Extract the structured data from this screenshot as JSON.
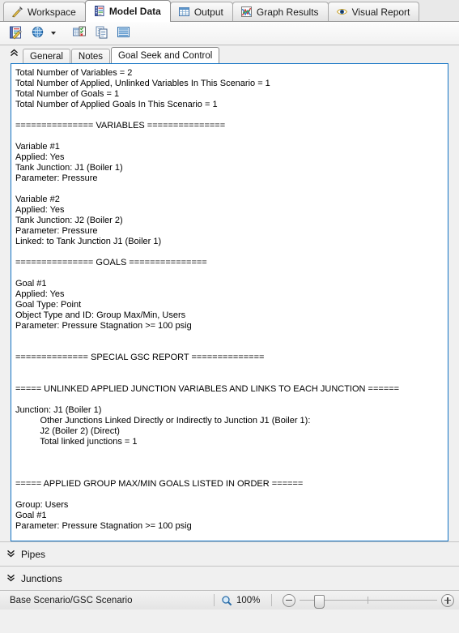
{
  "window": {
    "title": "Model Data - Goal Seek and Control"
  },
  "main_tabs": [
    {
      "label": "Workspace",
      "icon": "wrench-pencil-icon",
      "active": false
    },
    {
      "label": "Model Data",
      "icon": "notebook-icon",
      "active": true
    },
    {
      "label": "Output",
      "icon": "grid-table-icon",
      "active": false
    },
    {
      "label": "Graph Results",
      "icon": "chart-icon",
      "active": false
    },
    {
      "label": "Visual Report",
      "icon": "eye-icon",
      "active": false
    }
  ],
  "toolbar": {
    "buttons": [
      {
        "name": "edit-model-data-icon",
        "title": "Edit Model Data"
      },
      {
        "name": "globe-units-icon",
        "title": "Units"
      },
      {
        "name": "dropdown-caret-icon",
        "title": "More"
      },
      {
        "name": "show-object-status-icon",
        "title": "Show Object Status"
      },
      {
        "name": "copy-icon",
        "title": "Copy"
      },
      {
        "name": "list-lines-icon",
        "title": "Format"
      }
    ]
  },
  "sub_tabs": {
    "collapse_icon": "double-chevron-up-icon",
    "items": [
      {
        "label": "General",
        "active": false
      },
      {
        "label": "Notes",
        "active": false
      },
      {
        "label": "Goal Seek and Control",
        "active": true
      }
    ]
  },
  "report": {
    "lines": [
      "Total Number of Variables = 2",
      "Total Number of Applied, Unlinked Variables In This Scenario = 1",
      "Total Number of Goals = 1",
      "Total Number of Applied Goals In This Scenario = 1",
      "",
      "=============== VARIABLES ===============",
      "",
      "Variable #1",
      "Applied: Yes",
      "Tank Junction: J1 (Boiler 1)",
      "Parameter: Pressure",
      "",
      "Variable #2",
      "Applied: Yes",
      "Tank Junction: J2 (Boiler 2)",
      "Parameter: Pressure",
      "Linked: to Tank Junction J1 (Boiler 1)",
      "",
      "=============== GOALS ===============",
      "",
      "Goal #1",
      "Applied: Yes",
      "Goal Type: Point",
      "Object Type and ID: Group Max/Min, Users",
      "Parameter: Pressure Stagnation >= 100 psig",
      "",
      "",
      "============== SPECIAL GSC REPORT ==============",
      "",
      "",
      "===== UNLINKED APPLIED JUNCTION VARIABLES AND LINKS TO EACH JUNCTION ======",
      "",
      "Junction: J1 (Boiler 1)",
      "          Other Junctions Linked Directly or Indirectly to Junction J1 (Boiler 1):",
      "          J2 (Boiler 2) (Direct)",
      "          Total linked junctions = 1",
      "",
      "",
      "",
      "===== APPLIED GROUP MAX/MIN GOALS LISTED IN ORDER ======",
      "",
      "Group: Users",
      "Goal #1",
      "Parameter: Pressure Stagnation >= 100 psig"
    ]
  },
  "bottom_panes": [
    {
      "label": "Pipes",
      "icon": "double-chevron-down-icon"
    },
    {
      "label": "Junctions",
      "icon": "double-chevron-down-icon"
    }
  ],
  "statusbar": {
    "scenario": "Base Scenario/GSC Scenario",
    "zoom_icon": "magnifier-icon",
    "zoom_level": "100%",
    "zoom_out_icon": "minus-circle-icon",
    "zoom_in_icon": "plus-circle-icon"
  },
  "colors": {
    "panel_border": "#1273c4",
    "window_bg": "#f0f0f0",
    "text": "#000000"
  }
}
